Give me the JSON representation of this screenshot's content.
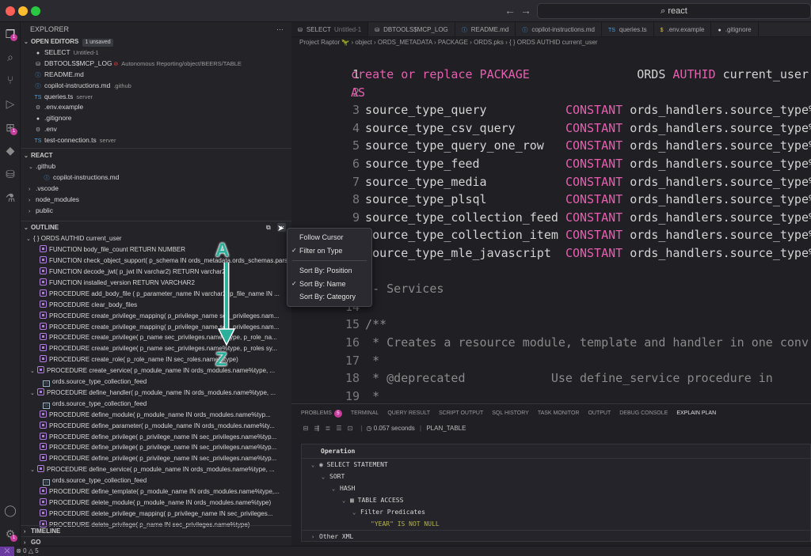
{
  "search": {
    "text": "react"
  },
  "explorer": {
    "title": "EXPLORER",
    "more": "···",
    "open_editors": {
      "label": "OPEN EDITORS",
      "badge": "1 unsaved",
      "items": [
        {
          "icon": "dot",
          "name": "SELECT",
          "sub": "Untitled-1"
        },
        {
          "icon": "db",
          "name": "DBTOOLS$MCP_LOG",
          "sub": "Autonomous Reporting/object/BEERS/TABLE"
        },
        {
          "icon": "info",
          "name": "README.md",
          "sub": ""
        },
        {
          "icon": "info",
          "name": "copilot-instructions.md",
          "sub": ".github"
        },
        {
          "icon": "TS",
          "name": "queries.ts",
          "sub": "server"
        },
        {
          "icon": "gear",
          "name": ".env.example",
          "sub": ""
        },
        {
          "icon": "dot",
          "name": ".gitignore",
          "sub": ""
        },
        {
          "icon": "gear",
          "name": ".env",
          "sub": ""
        },
        {
          "icon": "TS",
          "name": "test-connection.ts",
          "sub": "server"
        }
      ]
    },
    "react": {
      "label": "REACT",
      "items": [
        {
          "chev": "⌄",
          "name": ".github"
        },
        {
          "chev": "",
          "name": "copilot-instructions.md"
        },
        {
          "chev": "›",
          "name": ".vscode"
        },
        {
          "chev": "›",
          "name": "node_modules"
        },
        {
          "chev": "›",
          "name": "public"
        }
      ]
    }
  },
  "outline": {
    "label": "OUTLINE",
    "root": "{ } ORDS AUTHID current_user",
    "items": [
      {
        "type": "fn",
        "text": "FUNCTION body_file_count RETURN NUMBER"
      },
      {
        "type": "fn",
        "text": "FUNCTION check_object_support( p_schema IN ords_metadata.ords_schemas.parsing_sche..."
      },
      {
        "type": "fn",
        "text": "FUNCTION decode_jwt( p_jwt IN varchar2) RETURN varchar2"
      },
      {
        "type": "fn",
        "text": "FUNCTION installed_version RETURN VARCHAR2"
      },
      {
        "type": "fn",
        "text": "PROCEDURE add_body_file ( p_parameter_name IN varchar2, p_file_name IN ..."
      },
      {
        "type": "fn",
        "text": "PROCEDURE clear_body_files"
      },
      {
        "type": "fn",
        "text": "PROCEDURE create_privilege_mapping( p_privilege_name sec_privileges.nam..."
      },
      {
        "type": "fn",
        "text": "PROCEDURE create_privilege_mapping( p_privilege_name sec_privileges.nam..."
      },
      {
        "type": "fn",
        "text": "PROCEDURE create_privilege( p_name sec_privileges.name%type, p_role_na..."
      },
      {
        "type": "fn",
        "text": "PROCEDURE create_privilege( p_name sec_privileges.name%type, p_roles sy..."
      },
      {
        "type": "fn",
        "text": "PROCEDURE create_role( p_role_name IN sec_roles.name%type)"
      },
      {
        "type": "fn-exp",
        "text": "PROCEDURE create_service( p_module_name IN ords_modules.name%type, ..."
      },
      {
        "type": "const",
        "text": "ords.source_type_collection_feed"
      },
      {
        "type": "fn-exp",
        "text": "PROCEDURE define_handler( p_module_name IN ords_modules.name%type, ..."
      },
      {
        "type": "const",
        "text": "ords.source_type_collection_feed"
      },
      {
        "type": "fn",
        "text": "PROCEDURE define_module( p_module_name IN ords_modules.name%typ..."
      },
      {
        "type": "fn",
        "text": "PROCEDURE define_parameter( p_module_name IN ords_modules.name%ty..."
      },
      {
        "type": "fn",
        "text": "PROCEDURE define_privilege( p_privilege_name IN sec_privileges.name%typ..."
      },
      {
        "type": "fn",
        "text": "PROCEDURE define_privilege( p_privilege_name IN sec_privileges.name%typ..."
      },
      {
        "type": "fn",
        "text": "PROCEDURE define_privilege( p_privilege_name IN sec_privileges.name%typ..."
      },
      {
        "type": "fn-exp",
        "text": "PROCEDURE define_service( p_module_name IN ords_modules.name%type, ..."
      },
      {
        "type": "const",
        "text": "ords.source_type_collection_feed"
      },
      {
        "type": "fn",
        "text": "PROCEDURE define_template( p_module_name IN ords_modules.name%type,..."
      },
      {
        "type": "fn",
        "text": "PROCEDURE delete_module( p_module_name IN ords_modules.name%type)"
      },
      {
        "type": "fn",
        "text": "PROCEDURE delete_privilege_mapping( p_privilege_name IN sec_privileges..."
      },
      {
        "type": "fn",
        "text": "PROCEDURE delete_privilege( p_name IN sec_privileges.name%type)"
      }
    ],
    "timeline": "TIMELINE",
    "go": "GO"
  },
  "sort_menu": {
    "items": [
      {
        "label": "Follow Cursor",
        "checked": false
      },
      {
        "label": "Filter on Type",
        "checked": true
      },
      {
        "label": "Sort By: Position",
        "checked": false
      },
      {
        "label": "Sort By: Name",
        "checked": true
      },
      {
        "label": "Sort By: Category",
        "checked": false
      }
    ]
  },
  "annotation": {
    "a": "A",
    "z": "Z"
  },
  "tabs": [
    {
      "icon": "db",
      "label": "SELECT",
      "sub": "Untitled-1"
    },
    {
      "icon": "db",
      "label": "DBTOOLS$MCP_LOG",
      "sub": ""
    },
    {
      "icon": "info",
      "label": "README.md",
      "sub": ""
    },
    {
      "icon": "info",
      "label": "copilot-instructions.md",
      "sub": ""
    },
    {
      "icon": "TS",
      "label": "queries.ts",
      "sub": ""
    },
    {
      "icon": "$",
      "label": ".env.example",
      "sub": ""
    },
    {
      "icon": "dot",
      "label": ".gitignore",
      "sub": ""
    }
  ],
  "breadcrumb": "Project Raptor 🦖 › object › ORDS_METADATA › PACKAGE › ORDS.pks › { } ORDS AUTHID current_user",
  "code": [
    {
      "n": "1",
      "parts": [
        [
          "kw",
          "create or replace PACKAGE"
        ],
        [
          "t",
          "               ORDS "
        ],
        [
          "kw",
          "AUTHID"
        ],
        [
          "t",
          " current_user"
        ]
      ]
    },
    {
      "n": "2",
      "parts": [
        [
          "kw",
          "AS"
        ]
      ]
    },
    {
      "n": "3",
      "parts": [
        [
          "t",
          "  source_type_query           "
        ],
        [
          "kw",
          "CONSTANT"
        ],
        [
          "t",
          " ords_handlers.source_type%"
        ]
      ]
    },
    {
      "n": "4",
      "parts": [
        [
          "t",
          "  source_type_csv_query       "
        ],
        [
          "kw",
          "CONSTANT"
        ],
        [
          "t",
          " ords_handlers.source_type%"
        ]
      ]
    },
    {
      "n": "5",
      "parts": [
        [
          "t",
          "  source_type_query_one_row   "
        ],
        [
          "kw",
          "CONSTANT"
        ],
        [
          "t",
          " ords_handlers.source_type%"
        ]
      ]
    },
    {
      "n": "6",
      "parts": [
        [
          "t",
          "  source_type_feed            "
        ],
        [
          "kw",
          "CONSTANT"
        ],
        [
          "t",
          " ords_handlers.source_type%"
        ]
      ]
    },
    {
      "n": "7",
      "parts": [
        [
          "t",
          "  source_type_media           "
        ],
        [
          "kw",
          "CONSTANT"
        ],
        [
          "t",
          " ords_handlers.source_type%"
        ]
      ]
    },
    {
      "n": "8",
      "parts": [
        [
          "t",
          "  source_type_plsql           "
        ],
        [
          "kw",
          "CONSTANT"
        ],
        [
          "t",
          " ords_handlers.source_type%"
        ]
      ]
    },
    {
      "n": "9",
      "parts": [
        [
          "t",
          "  source_type_collection_feed "
        ],
        [
          "kw",
          "CONSTANT"
        ],
        [
          "t",
          " ords_handlers.source_type%"
        ]
      ]
    },
    {
      "n": "10",
      "parts": [
        [
          "t",
          "  source_type_collection_item "
        ],
        [
          "kw",
          "CONSTANT"
        ],
        [
          "t",
          " ords_handlers.source_type%"
        ]
      ]
    },
    {
      "n": "11",
      "parts": [
        [
          "t",
          "  source_type_mle_javascript  "
        ],
        [
          "kw",
          "CONSTANT"
        ],
        [
          "t",
          " ords_handlers.source_type%"
        ]
      ]
    },
    {
      "n": "12",
      "parts": [
        [
          "t",
          ""
        ]
      ]
    },
    {
      "n": "13",
      "parts": [
        [
          "cm",
          "  -- Services"
        ]
      ]
    },
    {
      "n": "14",
      "parts": [
        [
          "t",
          ""
        ]
      ]
    },
    {
      "n": "15",
      "parts": [
        [
          "cm",
          "  /**"
        ]
      ]
    },
    {
      "n": "16",
      "parts": [
        [
          "cm",
          "   * Creates a resource module, template and handler in one conv"
        ]
      ]
    },
    {
      "n": "17",
      "parts": [
        [
          "cm",
          "   *"
        ]
      ]
    },
    {
      "n": "18",
      "parts": [
        [
          "cm",
          "   * @deprecated            Use define_service procedure in"
        ]
      ]
    },
    {
      "n": "19",
      "parts": [
        [
          "cm",
          "   *"
        ]
      ]
    }
  ],
  "panel": {
    "tabs": [
      {
        "label": "PROBLEMS",
        "badge": "5"
      },
      {
        "label": "TERMINAL",
        "badge": ""
      },
      {
        "label": "QUERY RESULT",
        "badge": ""
      },
      {
        "label": "SCRIPT OUTPUT",
        "badge": ""
      },
      {
        "label": "SQL HISTORY",
        "badge": ""
      },
      {
        "label": "TASK MONITOR",
        "badge": ""
      },
      {
        "label": "OUTPUT",
        "badge": ""
      },
      {
        "label": "DEBUG CONSOLE",
        "badge": ""
      },
      {
        "label": "EXPLAIN PLAN",
        "badge": ""
      }
    ],
    "time": "0.057 seconds",
    "plan_table": "PLAN_TABLE",
    "header": "Operation",
    "rows": [
      {
        "indent": 0,
        "chev": "⌄",
        "icon": "◉",
        "text": "SELECT STATEMENT",
        "color": "#d8d8d8"
      },
      {
        "indent": 1,
        "chev": "⌄",
        "icon": "",
        "text": "SORT",
        "color": "#d8d8d8"
      },
      {
        "indent": 2,
        "chev": "⌄",
        "icon": "",
        "text": "HASH",
        "color": "#d8d8d8"
      },
      {
        "indent": 3,
        "chev": "⌄",
        "icon": "▦",
        "text": "TABLE ACCESS",
        "color": "#d8d8d8"
      },
      {
        "indent": 4,
        "chev": "⌄",
        "icon": "",
        "text": "Filter Predicates",
        "color": "#d8d8d8"
      },
      {
        "indent": 5,
        "chev": "",
        "icon": "",
        "text": "\"YEAR\" IS NOT NULL",
        "color": "#b5b54a"
      },
      {
        "indent": 0,
        "chev": "›",
        "icon": "",
        "text": "Other XML",
        "color": "#d8d8d8"
      }
    ]
  },
  "status": {
    "errors": "0",
    "warnings": "5"
  },
  "colors": {
    "accent": "#c83c9c",
    "keyword": "#e75fb0",
    "annotation": "#2bb09c"
  }
}
